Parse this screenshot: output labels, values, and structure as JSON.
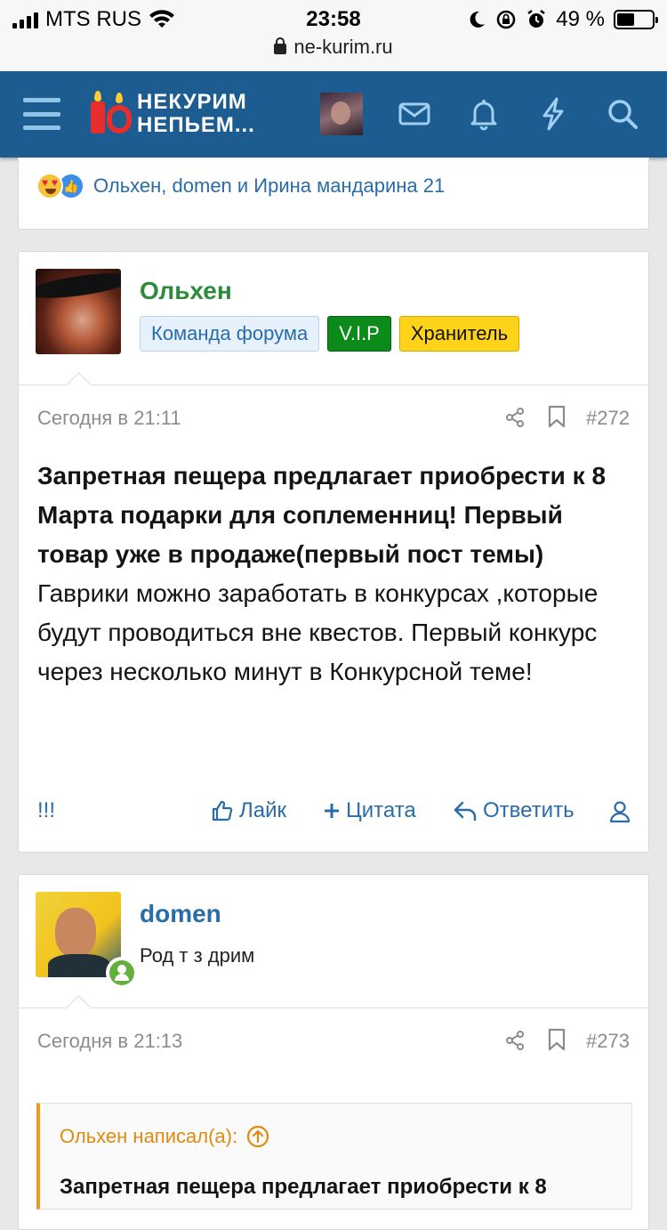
{
  "status_bar": {
    "carrier": "MTS RUS",
    "time": "23:58",
    "battery_percent": "49 %",
    "url": "ne-kurim.ru"
  },
  "navbar": {
    "logo_line1": "НЕКУРИМ",
    "logo_line2": "НЕПЬЕМ..."
  },
  "reactions_bar": {
    "text": "Ольхен, domen и Ирина мандарина 21"
  },
  "posts": [
    {
      "username": "Ольхен",
      "badges": [
        "Команда форума",
        "V.I.P",
        "Хранитель"
      ],
      "date": "Сегодня в 21:11",
      "number": "#272",
      "body_bold": "Запретная пещера предлагает приобрести к 8 Марта подарки для соплеменниц! Первый товар уже в продаже(первый пост темы)",
      "body_text": "Гаврики можно заработать в конкурсах ,которые будут проводиться вне квестов. Первый конкурс через несколько минут в Конкурсной теме!",
      "actions": {
        "report": "!!!",
        "like": "Лайк",
        "quote": "Цитата",
        "reply": "Ответить"
      }
    },
    {
      "username": "domen",
      "user_title": "Род т з дрим",
      "date": "Сегодня в 21:13",
      "number": "#273",
      "quote_author": "Ольхен написал(а):",
      "quote_text": "Запретная пещера предлагает приобрести к 8"
    }
  ],
  "colors": {
    "nav_bg": "#1c5c90",
    "link": "#2a6ca8",
    "username_green": "#2e8b3e",
    "quote_accent": "#f39a1c"
  }
}
